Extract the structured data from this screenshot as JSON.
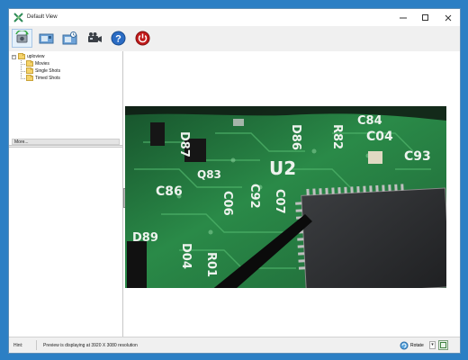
{
  "window": {
    "title": "Default View"
  },
  "toolbar": {
    "buttons": [
      {
        "icon": "refresh-camera-icon"
      },
      {
        "icon": "capture-image-icon"
      },
      {
        "icon": "timed-capture-icon"
      },
      {
        "icon": "video-camera-icon"
      },
      {
        "icon": "help-icon"
      },
      {
        "icon": "power-icon"
      }
    ]
  },
  "tree": {
    "root": {
      "label": "uploview",
      "expander": "−"
    },
    "children": [
      {
        "label": "Movies"
      },
      {
        "label": "Single Shots"
      },
      {
        "label": "Timed Shots"
      }
    ]
  },
  "more_bar": {
    "label": "More..."
  },
  "statusbar": {
    "hint_label": "Hint:",
    "message": "Preview is displaying at 3920 X 3080 resolution",
    "rotate_label": "Rotate",
    "rotate_dropdown": "▾"
  },
  "pcb_labels": {
    "d87": "D87",
    "d86": "D86",
    "r82": "R82",
    "c84": "C84",
    "c04": "C04",
    "c93": "C93",
    "q83": "Q83",
    "u2": "U2",
    "c86": "C86",
    "c06": "C06",
    "c92": "C92",
    "c07": "C07",
    "d89": "D89",
    "d04": "D04",
    "r01": "R01"
  },
  "colors": {
    "desktop": "#2c7fc4",
    "pcb_green": "#1f6a37",
    "power_red": "#c21b1b",
    "help_blue": "#2b6cc4"
  }
}
